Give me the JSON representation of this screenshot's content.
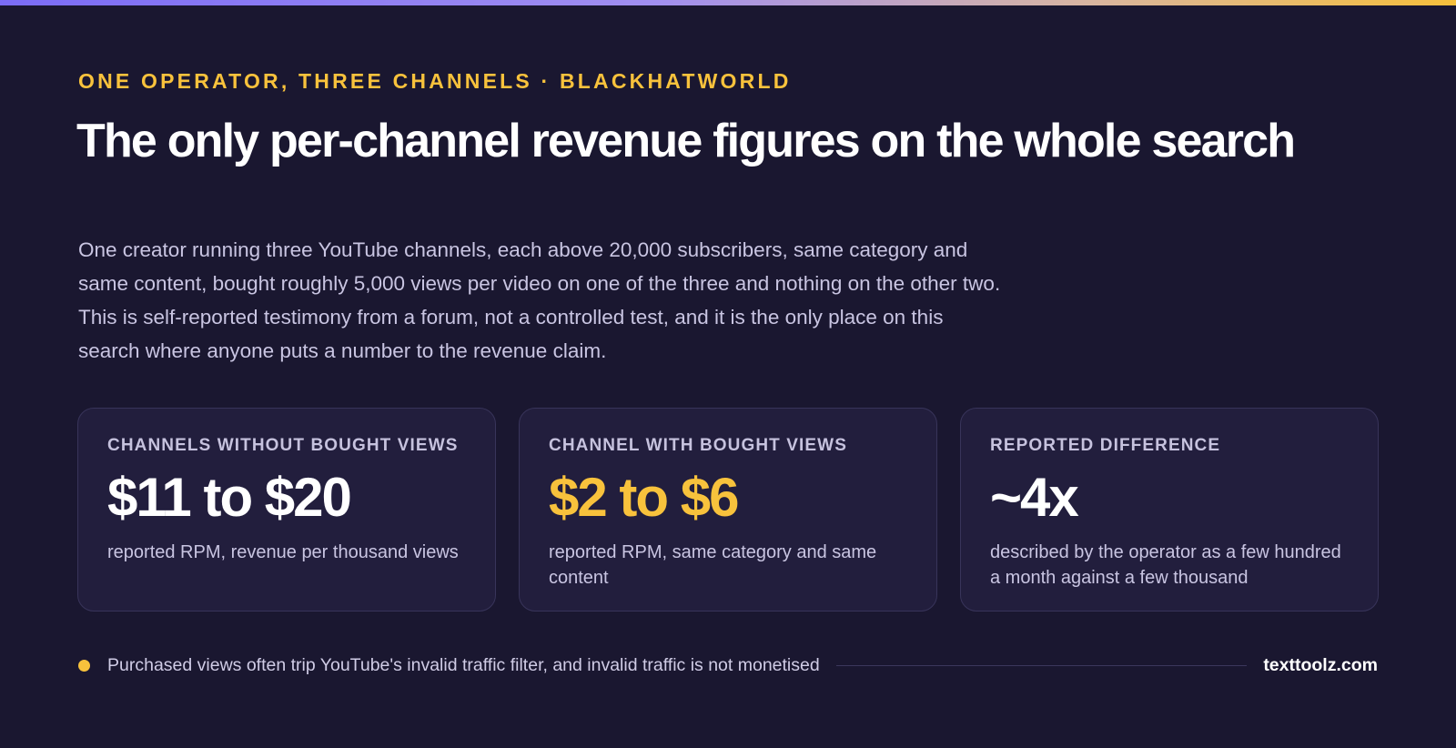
{
  "eyebrow": "ONE OPERATOR, THREE CHANNELS · BLACKHATWORLD",
  "title": "The only per-channel revenue figures on the whole search",
  "lede": [
    "One creator running three YouTube channels, each above 20,000 subscribers, same category and",
    "same content, bought roughly 5,000 views per video on one of the three and nothing on the other two.",
    "This is self-reported testimony from a forum, not a controlled test, and it is the only place on this",
    "search where anyone puts a number to the revenue claim."
  ],
  "cards": [
    {
      "label": "CHANNELS WITHOUT BOUGHT VIEWS",
      "value": "$11 to $20",
      "description": "reported RPM, revenue per thousand views"
    },
    {
      "label": "CHANNEL WITH BOUGHT VIEWS",
      "value": "$2 to $6",
      "description": "reported RPM, same category and same content"
    },
    {
      "label": "REPORTED DIFFERENCE",
      "value": "~4x",
      "description": "described by the operator as a few hundred a month against a few thousand"
    }
  ],
  "footer": {
    "note": "Purchased views often trip YouTube's invalid traffic filter, and invalid traffic is not monetised",
    "brand": "texttoolz.com"
  },
  "colors": {
    "background": "#1a1730",
    "card_background": "#221e3d",
    "accent": "#f8c23c",
    "gradient_start": "#7b6cf6",
    "gradient_end": "#f7c03b"
  }
}
